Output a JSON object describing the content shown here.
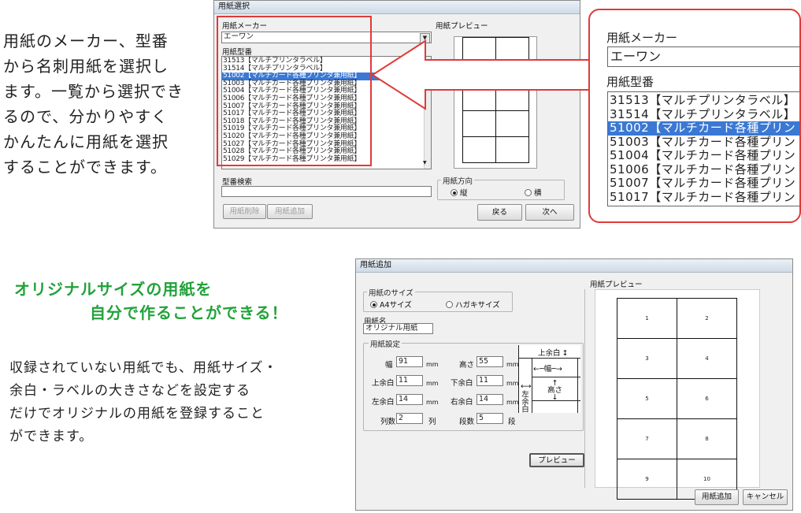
{
  "intro_text": [
    "用紙のメーカー、型番",
    "から名刺用紙を選択し",
    "ます。一覧から選択でき",
    "るので、分かりやすく",
    "かんたんに用紙を選択",
    "することができます。"
  ],
  "headline": [
    "オリジナルサイズの用紙を",
    "自分で作ることができる！"
  ],
  "body_text": [
    "収録されていない用紙でも、用紙サイズ・",
    "余白・ラベルの大きさなどを設定する",
    "だけでオリジナルの用紙を登録すること",
    "ができます。"
  ],
  "colors": {
    "accent_red": "#e03a3a",
    "headline_green": "#22a23a",
    "selection_blue": "#3a78d4"
  },
  "select_dialog": {
    "title": "用紙選択",
    "maker_label": "用紙メーカー",
    "maker_value": "エーワン",
    "model_label": "用紙型番",
    "models": [
      "31513【マルチプリンタラベル】",
      "31514【マルチプリンタラベル】",
      "51002【マルチカード各種プリンタ兼用紙】",
      "51003【マルチカード各種プリンタ兼用紙】",
      "51004【マルチカード各種プリンタ兼用紙】",
      "51006【マルチカード各種プリンタ兼用紙】",
      "51007【マルチカード各種プリンタ兼用紙】",
      "51017【マルチカード各種プリンタ兼用紙】",
      "51018【マルチカード各種プリンタ兼用紙】",
      "51019【マルチカード各種プリンタ兼用紙】",
      "51020【マルチカード各種プリンタ兼用紙】",
      "51027【マルチカード各種プリンタ兼用紙】",
      "51028【マルチカード各種プリンタ兼用紙】",
      "51029【マルチカード各種プリンタ兼用紙】"
    ],
    "selected_model": "51002【マルチカード各種プリンタ兼用紙】",
    "preview_label": "用紙プレビュー",
    "search_label": "型番検索",
    "orientation_label": "用紙方向",
    "orientation_portrait": "縦",
    "orientation_landscape": "横",
    "btn_delete": "用紙削除",
    "btn_add": "用紙追加",
    "btn_back": "戻る",
    "btn_next": "次へ"
  },
  "zoom": {
    "maker_label": "用紙メーカー",
    "maker_value": "エーワン",
    "model_label": "用紙型番",
    "models": [
      "31513【マルチプリンタラベル】",
      "31514【マルチプリンタラベル】",
      "51002【マルチカード各種プリン",
      "51003【マルチカード各種プリン",
      "51004【マルチカード各種プリン",
      "51006【マルチカード各種プリン",
      "51007【マルチカード各種プリン",
      "51017【マルチカード各種プリン"
    ],
    "selected_index": 2
  },
  "add_dialog": {
    "title": "用紙追加",
    "size_group_label": "用紙のサイズ",
    "size_a4": "A4サイズ",
    "size_hagaki": "ハガキサイズ",
    "name_label": "用紙名",
    "name_value": "オリジナル用紙",
    "settings_label": "用紙設定",
    "width_label": "幅",
    "width_value": "91",
    "height_label": "高さ",
    "height_value": "55",
    "top_label": "上余白",
    "top_value": "11",
    "bottom_label": "下余白",
    "bottom_value": "11",
    "left_label": "左余白",
    "left_value": "14",
    "right_label": "右余白",
    "right_value": "14",
    "cols_label": "列数",
    "cols_value": "2",
    "cols_unit": "列",
    "rows_label": "段数",
    "rows_value": "5",
    "rows_unit": "段",
    "unit_mm": "mm",
    "diagram_top": "上余白",
    "diagram_width": "幅",
    "diagram_height": "高さ",
    "diagram_left": "左余白",
    "preview_button": "プレビュー",
    "preview_label": "用紙プレビュー",
    "cell_numbers": [
      "1",
      "2",
      "3",
      "4",
      "5",
      "6",
      "7",
      "8",
      "9",
      "10"
    ],
    "btn_add": "用紙追加",
    "btn_cancel": "キャンセル"
  }
}
